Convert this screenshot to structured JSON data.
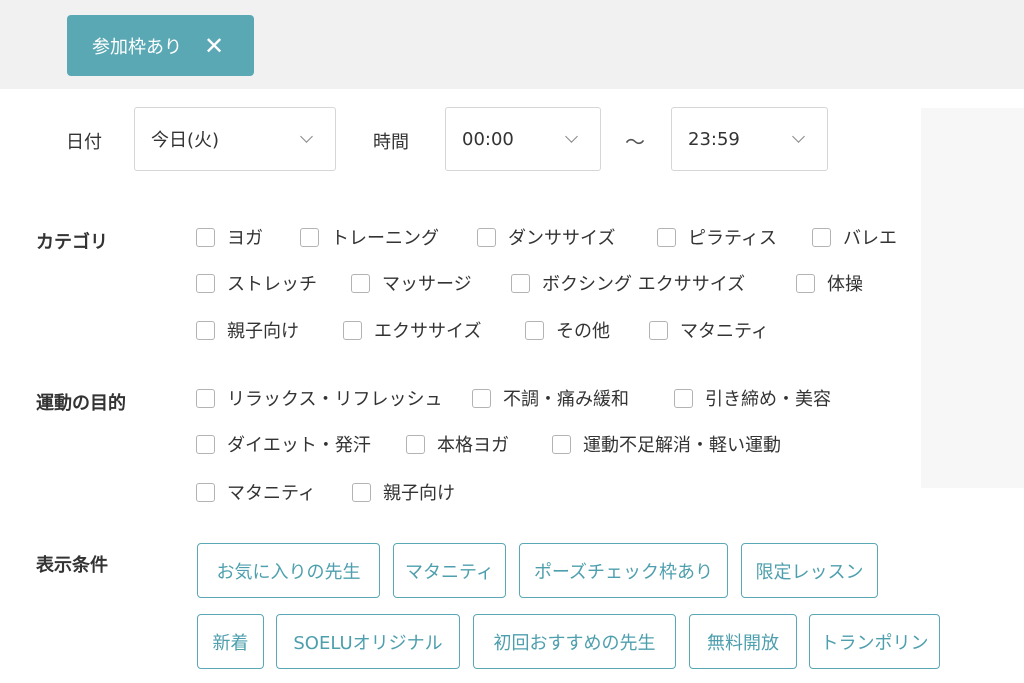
{
  "active_filter": {
    "label": "参加枠あり",
    "close_glyph": "✕"
  },
  "date": {
    "label": "日付",
    "value": "今日(火)"
  },
  "time": {
    "label": "時間",
    "start": "00:00",
    "separator": "〜",
    "end": "23:59"
  },
  "category": {
    "title": "カテゴリ",
    "options": [
      "ヨガ",
      "トレーニング",
      "ダンササイズ",
      "ピラティス",
      "バレエ",
      "ストレッチ",
      "マッサージ",
      "ボクシング エクササイズ",
      "体操",
      "親子向け",
      "エクササイズ",
      "その他",
      "マタニティ"
    ]
  },
  "purpose": {
    "title": "運動の目的",
    "options": [
      "リラックス・リフレッシュ",
      "不調・痛み緩和",
      "引き締め・美容",
      "ダイエット・発汗",
      "本格ヨガ",
      "運動不足解消・軽い運動",
      "マタニティ",
      "親子向け"
    ]
  },
  "display": {
    "title": "表示条件",
    "tags": [
      "お気に入りの先生",
      "マタニティ",
      "ポーズチェック枠あり",
      "限定レッスン",
      "新着",
      "SOELUオリジナル",
      "初回おすすめの先生",
      "無料開放",
      "トランポリン"
    ]
  },
  "colors": {
    "accent": "#5ba8b5",
    "topbar": "#f1f1f1",
    "text": "#333333"
  }
}
